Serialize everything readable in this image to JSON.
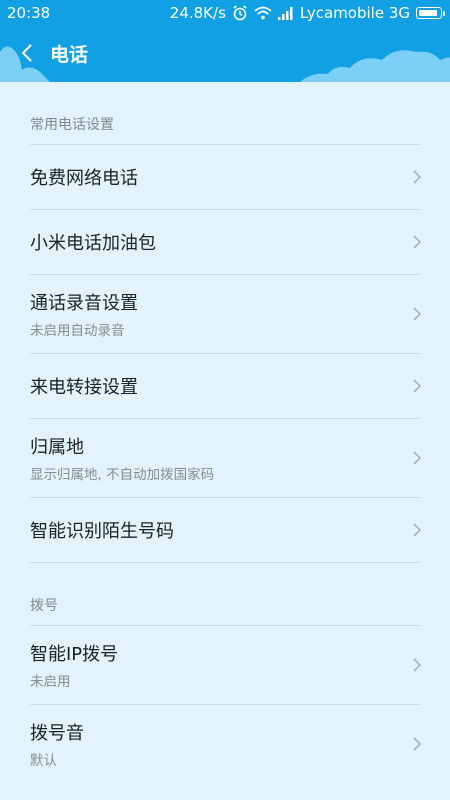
{
  "status": {
    "time": "20:38",
    "speed": "24.8K/s",
    "carrier": "Lycamobile 3G",
    "battery_level": 0.9
  },
  "nav": {
    "title": "电话"
  },
  "sections": [
    {
      "header": "常用电话设置",
      "items": [
        {
          "title": "免费网络电话"
        },
        {
          "title": "小米电话加油包"
        },
        {
          "title": "通话录音设置",
          "subtitle": "未启用自动录音"
        },
        {
          "title": "来电转接设置"
        },
        {
          "title": "归属地",
          "subtitle": "显示归属地, 不自动加拨国家码"
        },
        {
          "title": "智能识别陌生号码"
        }
      ]
    },
    {
      "header": "拨号",
      "items": [
        {
          "title": "智能IP拨号",
          "subtitle": "未启用"
        },
        {
          "title": "拨号音",
          "subtitle": "默认"
        }
      ]
    }
  ],
  "colors": {
    "header_bg": "#12a0e4",
    "page_bg": "#e2f3fb",
    "cloud": "#7cd0f5"
  }
}
